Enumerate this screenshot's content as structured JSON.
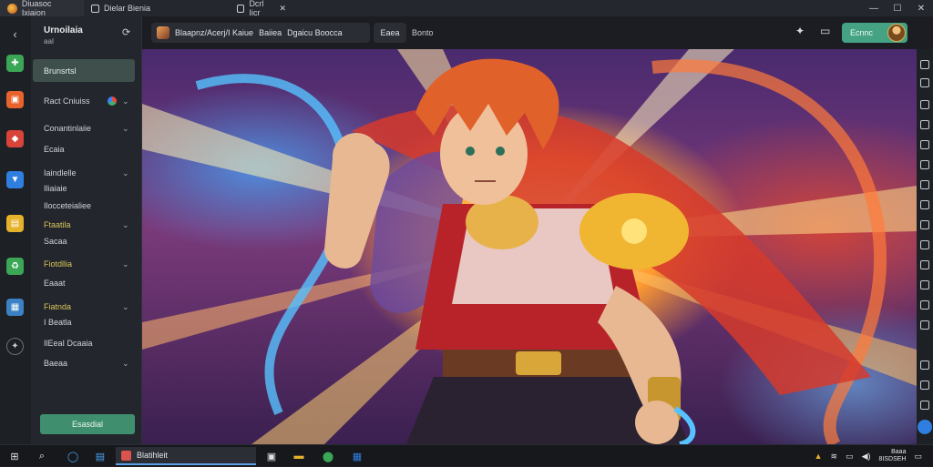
{
  "window": {
    "tabs": [
      {
        "label": "Diuasoc Ixiaion"
      },
      {
        "label": "Dielar Bienia"
      },
      {
        "label": "Dcrl Iicr"
      }
    ],
    "controls": {
      "minimize": "—",
      "maximize": "☐",
      "close": "✕"
    }
  },
  "sidebar": {
    "title": "Urnoilaia",
    "subtitle": "aaI",
    "active_item": "Brunsrtsl",
    "items": [
      {
        "label": "Ract Cniuiss"
      },
      {
        "label": "Conantinlaiie"
      },
      {
        "label": "Ecaia"
      },
      {
        "label": "Iaindlelle"
      },
      {
        "label": "Iliaiaie"
      },
      {
        "label": "Ilocceteialiee"
      },
      {
        "label": "Ftaatila"
      },
      {
        "label": "Sacaa"
      },
      {
        "label": "Fiotdllia"
      },
      {
        "label": "Eaaat"
      },
      {
        "label": "Fiatnda"
      },
      {
        "label": "I Beatla"
      },
      {
        "label": "IlEeaI Dcaaia"
      },
      {
        "label": "Baeaa"
      }
    ],
    "bottom_button": "Esasdial"
  },
  "toolbar": {
    "search_value": "Blaapnz/Acerj/I Kaiue",
    "filter1": "Baiiea",
    "filter2": "Dgaicu Boocca",
    "chip1": "Eaea",
    "chip2": "Bonto",
    "primary_button": "Ecnnc"
  },
  "taskbar": {
    "app_label": "Blatihleit",
    "clock_time": "Baaa",
    "clock_date": "8ISDSEH"
  },
  "colors": {
    "accent": "#45a283",
    "sidebar_bg": "#23262c",
    "highlight_text": "#d8c65a"
  },
  "icons": {
    "rail": [
      "back-icon",
      "gamepad-icon",
      "store-icon",
      "controller-icon",
      "download-icon",
      "folder-icon",
      "recycle-icon",
      "window-icon",
      "settings-icon"
    ],
    "toolbar": [
      "pin-icon",
      "screen-icon"
    ]
  }
}
